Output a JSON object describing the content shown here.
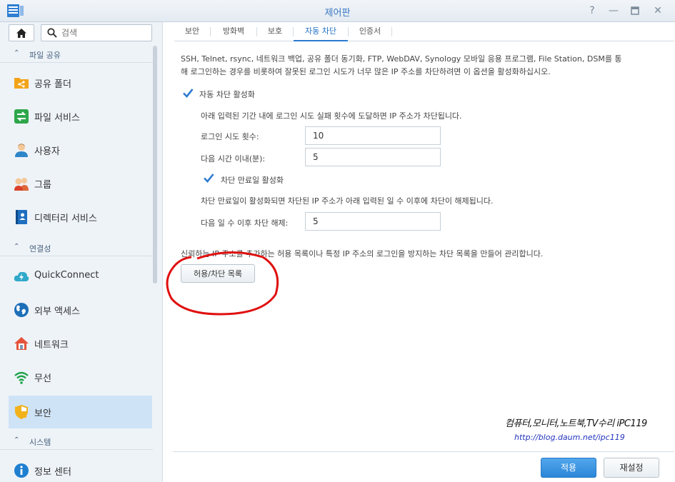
{
  "window": {
    "title": "제어판"
  },
  "sidebar": {
    "search_placeholder": "검색",
    "sections": [
      {
        "label": "파일 공유"
      },
      {
        "label": "연결성"
      },
      {
        "label": "시스템"
      }
    ],
    "items": [
      {
        "label": "공유 폴더",
        "icon": "shared-folder-icon"
      },
      {
        "label": "파일 서비스",
        "icon": "file-services-icon"
      },
      {
        "label": "사용자",
        "icon": "user-icon"
      },
      {
        "label": "그룹",
        "icon": "group-icon"
      },
      {
        "label": "디렉터리 서비스",
        "icon": "directory-service-icon"
      },
      {
        "label": "QuickConnect",
        "icon": "quickconnect-icon"
      },
      {
        "label": "외부 액세스",
        "icon": "globe-icon"
      },
      {
        "label": "네트워크",
        "icon": "network-house-icon"
      },
      {
        "label": "무선",
        "icon": "wifi-icon"
      },
      {
        "label": "보안",
        "icon": "shield-icon",
        "active": true
      },
      {
        "label": "정보 센터",
        "icon": "info-icon"
      }
    ]
  },
  "tabs": [
    {
      "label": "보안"
    },
    {
      "label": "방화벽"
    },
    {
      "label": "보호"
    },
    {
      "label": "자동 차단",
      "active": true
    },
    {
      "label": "인증서"
    }
  ],
  "auto_block": {
    "description_line1": "SSH, Telnet, rsync, 네트워크 백업, 공유 폴더 동기화, FTP, WebDAV, Synology 모바일 응용 프로그램, File Station, DSM를 통",
    "description_line2": "해 로그인하는 경우를 비롯하여 잘못된 로그인 시도가 너무 많은 IP 주소를 차단하려면 이 옵션을 활성화하십시오.",
    "enable_label": "자동 차단 활성화",
    "enable_checked": true,
    "threshold_desc": "아래 입력된 기간 내에 로그인 시도 실패 횟수에 도달하면 IP 주소가 차단됩니다.",
    "login_attempts_label": "로그인 시도 횟수:",
    "login_attempts_value": "10",
    "within_minutes_label": "다음 시간 이내(분):",
    "within_minutes_value": "5",
    "expiration_label": "차단 만료일 활성화",
    "expiration_checked": true,
    "expiration_desc": "차단 만료일이 활성화되면 차단된 IP 주소가 아래 입력된 일 수 이후에 차단이 해제됩니다.",
    "unblock_days_label": "다음 일 수 이후 차단 해제:",
    "unblock_days_value": "5",
    "list_desc": "신뢰하는 IP 주소를 추가하는 허용 목록이나 특정 IP 주소의 로그인을 방지하는 차단 목록을 만들어 관리합니다.",
    "list_button": "허용/차단 목록"
  },
  "footer": {
    "apply": "적용",
    "reset": "재설정"
  },
  "watermark": {
    "line1": "컴퓨터,모니터,노트북,TV수리 iPC119",
    "line2": "http://blog.daum.net/ipc119"
  },
  "colors": {
    "accent": "#2b7bd1",
    "active_item_bg": "#cfe3f7",
    "annotation_red": "#e01010"
  }
}
